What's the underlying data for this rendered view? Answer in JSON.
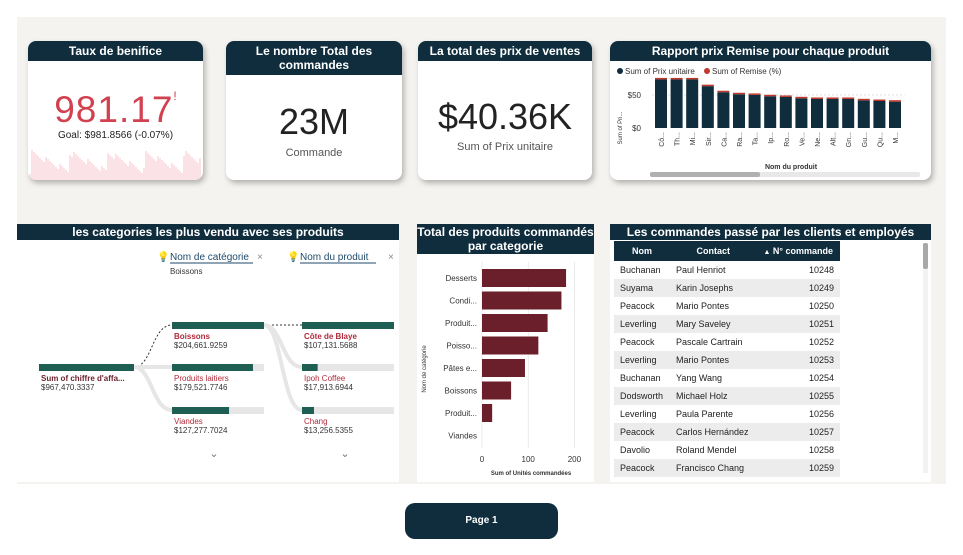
{
  "colors": {
    "navy": "#0f2d3d",
    "maroon": "#6b1f2a",
    "red": "#d2414f",
    "teal": "#1f5e52"
  },
  "kpi1": {
    "title": "Taux de benifice",
    "value": "981.17",
    "mark": "!",
    "goal": "Goal: $981.8566 (-0.07%)"
  },
  "kpi2": {
    "title": "Le nombre Total des commandes",
    "value": "23M",
    "caption": "Commande"
  },
  "kpi3": {
    "title": "La total des prix de ventes",
    "value": "$40.36K",
    "caption": "Sum of Prix unitaire"
  },
  "remise": {
    "title": "Rapport prix Remise pour chaque produit",
    "legend": [
      "Sum of Prix unitaire",
      "Sum of Remise (%)"
    ],
    "ylabel": "Sum of Pri...",
    "xlabel": "Nom du produit",
    "yticks": [
      "$50",
      "$0"
    ]
  },
  "decomp": {
    "title": "les categories les plus vendu avec ses produits",
    "filter1": "Nom de catégorie",
    "filter1_sub": "Boissons",
    "filter2": "Nom du produit",
    "root": {
      "label": "Sum of chiffre d'affa...",
      "value": "$967,470.3337"
    },
    "categories": [
      {
        "label": "Boissons",
        "value": "$204,661.9259",
        "frac": 1.0
      },
      {
        "label": "Produits laitiers",
        "value": "$179,521.7746",
        "frac": 0.88
      },
      {
        "label": "Viandes",
        "value": "$127,277.7024",
        "frac": 0.62
      }
    ],
    "products": [
      {
        "label": "Côte de Blaye",
        "value": "$107,131.5688",
        "frac": 1.0
      },
      {
        "label": "Ipoh Coffee",
        "value": "$17,913.6944",
        "frac": 0.17
      },
      {
        "label": "Chang",
        "value": "$13,256.5355",
        "frac": 0.13
      }
    ]
  },
  "chart_data": [
    {
      "type": "bar",
      "title": "Total des produits commandés par categorie",
      "xlabel": "Sum of Unités commandées",
      "ylabel": "Nom de catégorie",
      "categories": [
        "Desserts",
        "Condi...",
        "Produit...",
        "Poisso...",
        "Pâtes e...",
        "Boissons",
        "Produit...",
        "Viandes"
      ],
      "values": [
        182,
        172,
        142,
        122,
        93,
        63,
        22,
        0
      ],
      "xlim": [
        0,
        210
      ],
      "xticks": [
        0,
        100,
        200
      ]
    },
    {
      "type": "bar",
      "title": "Rapport prix Remise pour chaque produit",
      "xlabel": "Nom du produit",
      "ylabel": "Sum of Pri...",
      "categories": [
        "Cô...",
        "Th...",
        "Mi...",
        "Sir...",
        "Ca...",
        "Ra...",
        "Ta...",
        "Ip...",
        "Ro...",
        "Ve...",
        "Ne...",
        "Alt...",
        "Gn...",
        "Gu...",
        "Qu...",
        "M..."
      ],
      "series": [
        {
          "name": "Sum of Prix unitaire",
          "values": [
            72,
            72,
            72,
            62,
            53,
            50,
            49,
            47,
            46,
            44,
            43,
            43,
            43,
            41,
            40,
            39
          ]
        },
        {
          "name": "Sum of Remise (%)",
          "values": [
            0,
            0,
            0,
            0,
            0,
            0,
            0,
            0,
            0,
            0,
            0,
            0,
            0,
            0,
            0,
            0
          ]
        }
      ],
      "ylim": [
        0,
        80
      ],
      "yticks": [
        0,
        50
      ]
    }
  ],
  "orders": {
    "title": "Les commandes passé par les clients et employés",
    "headers": [
      "Nom",
      "Contact",
      "N° commande"
    ],
    "rows": [
      [
        "Buchanan",
        "Paul Henriot",
        "10248"
      ],
      [
        "Suyama",
        "Karin Josephs",
        "10249"
      ],
      [
        "Peacock",
        "Mario Pontes",
        "10250"
      ],
      [
        "Leverling",
        "Mary Saveley",
        "10251"
      ],
      [
        "Peacock",
        "Pascale Cartrain",
        "10252"
      ],
      [
        "Leverling",
        "Mario Pontes",
        "10253"
      ],
      [
        "Buchanan",
        "Yang Wang",
        "10254"
      ],
      [
        "Dodsworth",
        "Michael Holz",
        "10255"
      ],
      [
        "Leverling",
        "Paula Parente",
        "10256"
      ],
      [
        "Peacock",
        "Carlos Hernández",
        "10257"
      ],
      [
        "Davolio",
        "Roland Mendel",
        "10258"
      ],
      [
        "Peacock",
        "Francisco Chang",
        "10259"
      ]
    ]
  },
  "page": "Page 1"
}
